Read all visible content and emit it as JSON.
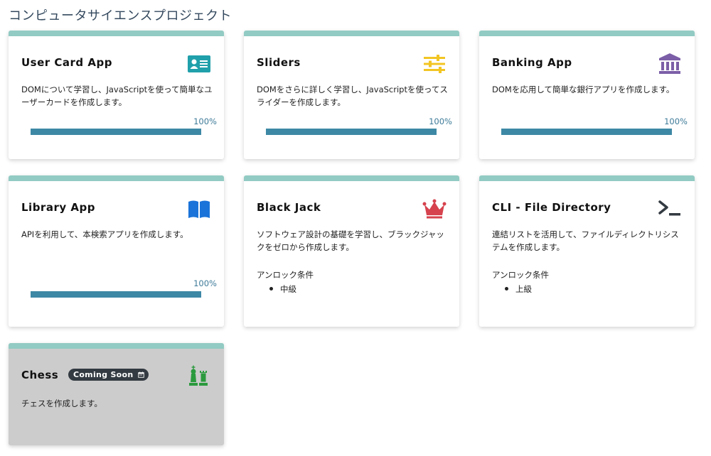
{
  "page": {
    "title": "コンピュータサイエンスプロジェクト"
  },
  "cards": [
    {
      "title": "User Card App",
      "icon": "id-card-icon",
      "description": "DOMについて学習し、JavaScriptを使って簡単なユーザーカードを作成します。",
      "progress": {
        "label": "100%",
        "value": 100
      }
    },
    {
      "title": "Sliders",
      "icon": "sliders-icon",
      "description": "DOMをさらに詳しく学習し、JavaScriptを使ってスライダーを作成します。",
      "progress": {
        "label": "100%",
        "value": 100
      }
    },
    {
      "title": "Banking App",
      "icon": "bank-icon",
      "description": "DOMを応用して簡単な銀行アプリを作成します。",
      "progress": {
        "label": "100%",
        "value": 100
      }
    },
    {
      "title": "Library App",
      "icon": "open-book-icon",
      "description": "APIを利用して、本検索アプリを作成します。",
      "progress": {
        "label": "100%",
        "value": 100
      }
    },
    {
      "title": "Black Jack",
      "icon": "crown-icon",
      "description": "ソフトウェア設計の基礎を学習し、ブラックジャックをゼロから作成します。",
      "unlock_label": "アンロック条件",
      "unlock_items": [
        "中級"
      ]
    },
    {
      "title": "CLI - File Directory",
      "icon": "terminal-icon",
      "description": "連結リストを活用して、ファイルディレクトリシステムを作成します。",
      "unlock_label": "アンロック条件",
      "unlock_items": [
        "上級"
      ]
    },
    {
      "title": "Chess",
      "icon": "chess-pieces-icon",
      "badge": "Coming Soon",
      "description": "チェスを作成します。"
    }
  ],
  "colors": {
    "card_accent": "#92cbc3",
    "progress": "#3d88a5",
    "locked_bg": "#cccccc",
    "id_card": "#20a0aa",
    "sliders": "#f2c523",
    "bank": "#7b5ea7",
    "book": "#1a73d9",
    "crown": "#d6424d",
    "terminal": "#333a41",
    "chess": "#2b9a3e"
  }
}
